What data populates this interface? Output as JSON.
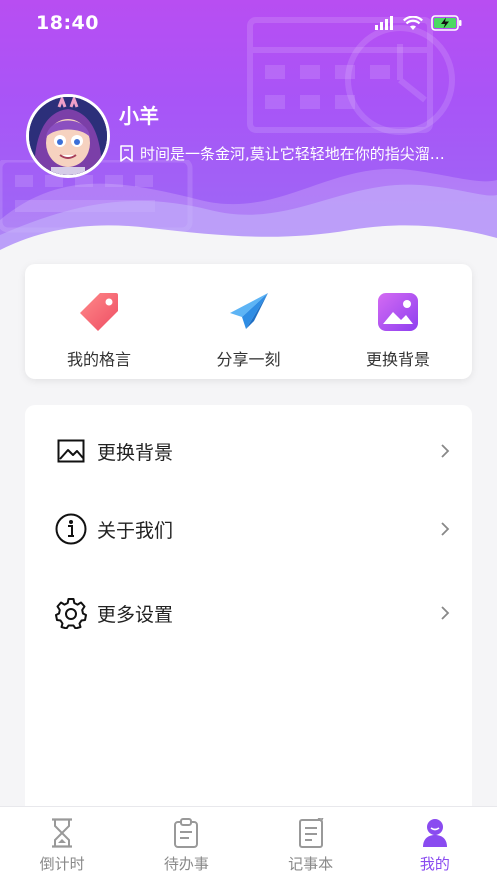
{
  "status_bar": {
    "time": "18:40"
  },
  "profile": {
    "username": "小羊",
    "motto": "时间是一条金河,莫让它轻轻地在你的指尖溜…"
  },
  "quick_actions": [
    {
      "label": "我的格言",
      "icon": "tag-icon"
    },
    {
      "label": "分享一刻",
      "icon": "paper-plane-icon"
    },
    {
      "label": "更换背景",
      "icon": "picture-icon"
    }
  ],
  "menu": [
    {
      "label": "更换背景",
      "icon": "image-icon"
    },
    {
      "label": "关于我们",
      "icon": "info-icon"
    },
    {
      "label": "更多设置",
      "icon": "gear-icon"
    }
  ],
  "tabs": [
    {
      "label": "倒计时",
      "icon": "hourglass-icon",
      "active": false
    },
    {
      "label": "待办事",
      "icon": "clipboard-icon",
      "active": false
    },
    {
      "label": "记事本",
      "icon": "notepad-icon",
      "active": false
    },
    {
      "label": "我的",
      "icon": "user-icon",
      "active": true
    }
  ],
  "colors": {
    "header_gradient_top": "#b84ef2",
    "header_gradient_bottom": "#9b6cf5",
    "active_tab": "#8a4bf0",
    "inactive_tab": "#8a8a8a",
    "tag_icon": "#f15b6c",
    "plane_icon": "#2f8de4"
  }
}
